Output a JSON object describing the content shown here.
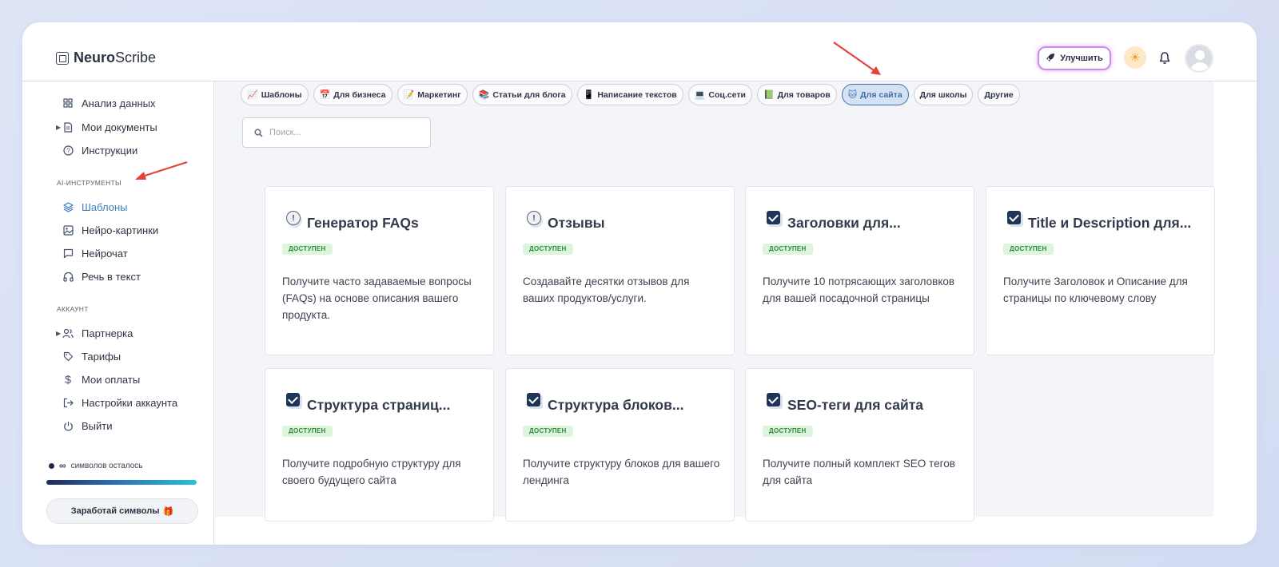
{
  "brand": {
    "bold": "Neuro",
    "rest": "Scribe"
  },
  "header": {
    "upgrade_label": "Улучшить",
    "sun_icon": "sun-icon",
    "bell_icon": "bell-icon"
  },
  "sidebar": {
    "items_top": [
      {
        "label": "Анализ данных",
        "icon": "grid-icon"
      },
      {
        "label": "Мои документы",
        "icon": "document-icon"
      },
      {
        "label": "Инструкции",
        "icon": "help-circle-icon"
      }
    ],
    "section_ai": "AI-ИНСТРУМЕНТЫ",
    "items_ai": [
      {
        "label": "Шаблоны",
        "icon": "layers-icon",
        "active": true
      },
      {
        "label": "Нейро-картинки",
        "icon": "image-icon"
      },
      {
        "label": "Нейрочат",
        "icon": "chat-icon"
      },
      {
        "label": "Речь в текст",
        "icon": "headphones-icon"
      }
    ],
    "section_account": "АККАУНТ",
    "items_account": [
      {
        "label": "Партнерка",
        "icon": "users-icon"
      },
      {
        "label": "Тарифы",
        "icon": "tag-icon"
      },
      {
        "label": "Мои оплаты",
        "icon": "dollar-icon"
      },
      {
        "label": "Настройки аккаунта",
        "icon": "logout-arrow-icon"
      },
      {
        "label": "Выйти",
        "icon": "power-icon"
      }
    ],
    "credits_value": "∞",
    "credits_label": "символов осталось",
    "credits_fill": 1.0,
    "earn_label": "Заработай символы",
    "earn_emoji": "🎁"
  },
  "chips": [
    {
      "emoji": "📈",
      "label": "Шаблоны"
    },
    {
      "emoji": "📅",
      "label": "Для бизнеса"
    },
    {
      "emoji": "📝",
      "label": "Маркетинг"
    },
    {
      "emoji": "📚",
      "label": "Статьи для блога"
    },
    {
      "emoji": "📱",
      "label": "Написание текстов"
    },
    {
      "emoji": "💻",
      "label": "Соц.сети"
    },
    {
      "emoji": "📗",
      "label": "Для товаров"
    },
    {
      "emoji": "🐱",
      "label": "Для сайта",
      "active": true
    },
    {
      "emoji": "",
      "label": "Для школы"
    },
    {
      "emoji": "",
      "label": "Другие"
    }
  ],
  "search": {
    "placeholder": "Поиск..."
  },
  "cards": [
    {
      "title": "Генератор FAQs",
      "icon": "info-icon",
      "badge": "ДОСТУПЕН",
      "desc": "Получите часто задаваемые вопросы (FAQs) на основе описания вашего продукта."
    },
    {
      "title": "Отзывы",
      "icon": "info-icon",
      "badge": "ДОСТУПЕН",
      "desc": "Создавайте десятки отзывов для ваших продуктов/услуги."
    },
    {
      "title": "Заголовки для...",
      "icon": "checkbox-icon",
      "badge": "ДОСТУПЕН",
      "desc": "Получите 10 потрясающих заголовков для вашей посадочной страницы"
    },
    {
      "title": "Title и Description для...",
      "icon": "checkbox-icon",
      "badge": "ДОСТУПЕН",
      "desc": "Получите Заголовок и Описание для страницы по ключевому слову"
    },
    {
      "title": "Структура страниц...",
      "icon": "checkbox-icon",
      "badge": "ДОСТУПЕН",
      "desc": "Получите подробную структуру для своего будущего сайта"
    },
    {
      "title": "Структура блоков...",
      "icon": "checkbox-icon",
      "badge": "ДОСТУПЕН",
      "desc": "Получите структуру блоков для вашего лендинга"
    },
    {
      "title": "SEO-теги для сайта",
      "icon": "checkbox-icon",
      "badge": "ДОСТУПЕН",
      "desc": "Получите полный комплект SEO тегов для сайта"
    }
  ],
  "colors": {
    "accent": "#3c7ebf",
    "badge_bg": "#dcf5dc",
    "badge_text": "#2d8a3a",
    "annotation_arrow": "#e8403a"
  }
}
